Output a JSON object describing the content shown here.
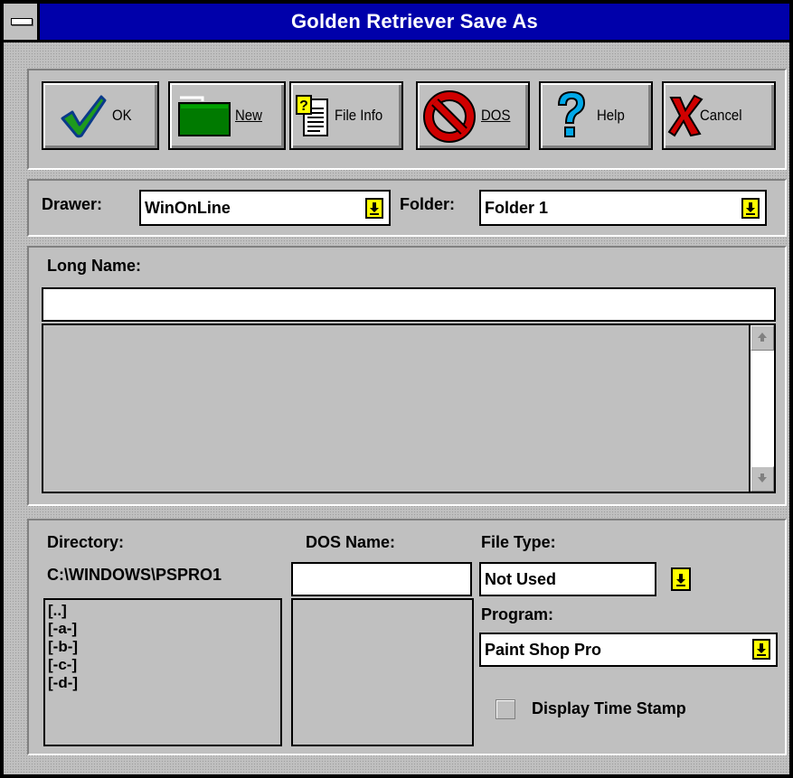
{
  "window": {
    "title": "Golden Retriever  Save As"
  },
  "toolbar": {
    "ok": "OK",
    "new": "New",
    "file_info": "File Info",
    "dos": "DOS",
    "help": "Help",
    "cancel": "Cancel"
  },
  "location": {
    "drawer_label": "Drawer:",
    "drawer_value": "WinOnLine",
    "folder_label": "Folder:",
    "folder_value": "Folder 1"
  },
  "long_name": {
    "label": "Long Name:",
    "value": ""
  },
  "bottom": {
    "directory_label": "Directory:",
    "directory_path": "C:\\WINDOWS\\PSPRO1",
    "dir_items": [
      "[..]",
      "[-a-]",
      "[-b-]",
      "[-c-]",
      "[-d-]"
    ],
    "dos_name_label": "DOS Name:",
    "dos_name_value": "",
    "file_type_label": "File Type:",
    "file_type_value": "Not Used",
    "program_label": "Program:",
    "program_value": "Paint Shop Pro",
    "timestamp_label": "Display Time Stamp",
    "timestamp_checked": false
  },
  "colors": {
    "titlebar": "#0000aa",
    "face": "#c0c0c0",
    "dropdown_button": "#ffff00"
  }
}
